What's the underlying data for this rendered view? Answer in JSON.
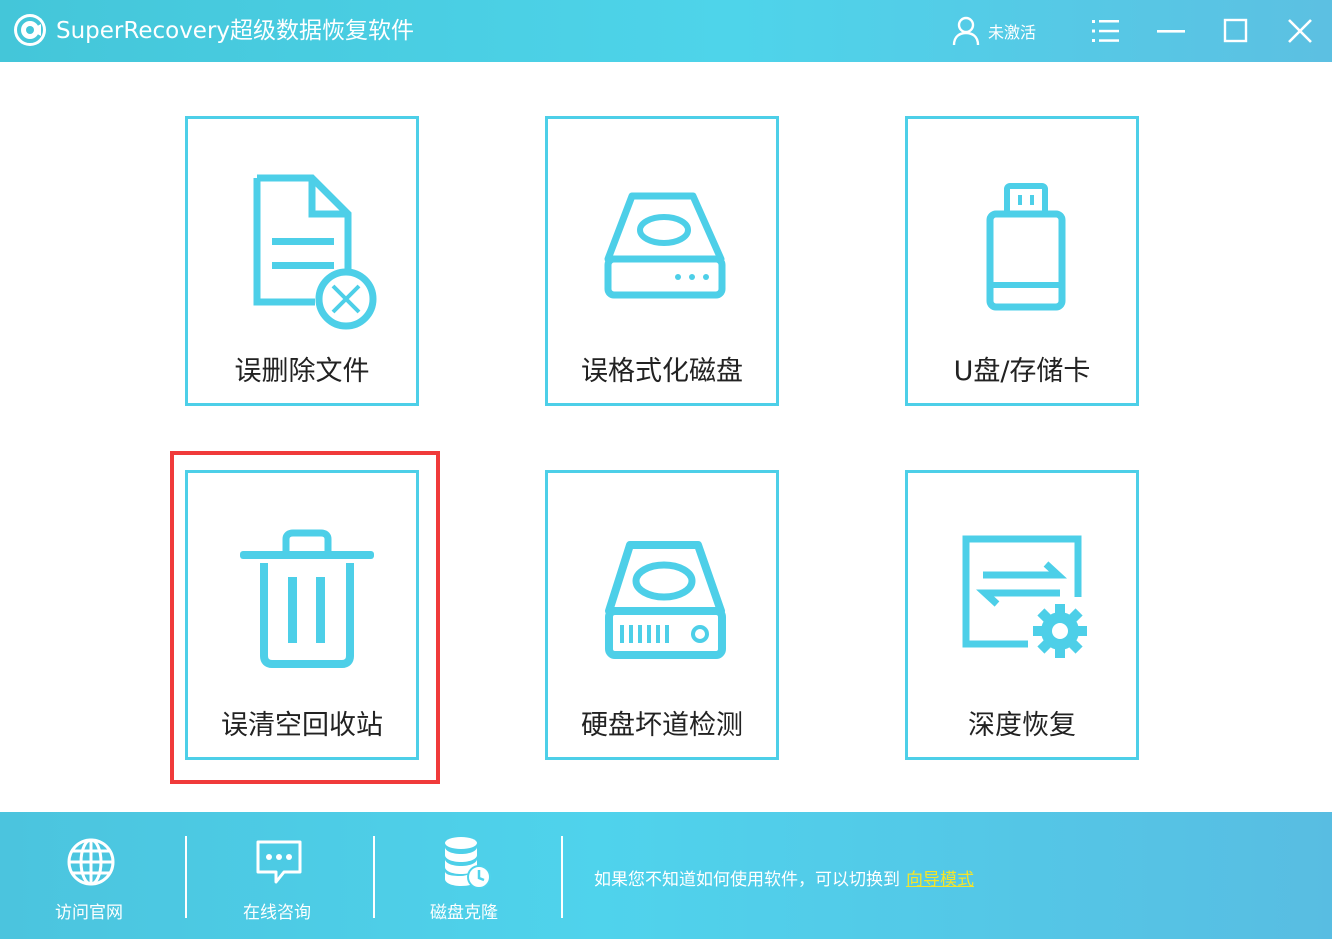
{
  "app": {
    "title": "SuperRecovery超级数据恢复软件",
    "user_status": "未激活"
  },
  "colors": {
    "accent": "#4dcfe8",
    "highlight": "#f03a3a",
    "link": "#f5e52a"
  },
  "tiles": [
    {
      "label": "误删除文件",
      "icon": "deleted-file-icon"
    },
    {
      "label": "误格式化磁盘",
      "icon": "disk-icon"
    },
    {
      "label": "U盘/存储卡",
      "icon": "usb-drive-icon"
    },
    {
      "label": "误清空回收站",
      "icon": "trash-icon",
      "highlighted": true
    },
    {
      "label": "硬盘坏道检测",
      "icon": "hard-drive-icon"
    },
    {
      "label": "深度恢复",
      "icon": "deep-recovery-icon"
    }
  ],
  "footer": {
    "items": [
      {
        "label": "访问官网",
        "icon": "globe-icon"
      },
      {
        "label": "在线咨询",
        "icon": "chat-icon"
      },
      {
        "label": "磁盘克隆",
        "icon": "database-clone-icon"
      }
    ],
    "hint_text": "如果您不知道如何使用软件，可以切换到",
    "hint_link": "向导模式"
  }
}
